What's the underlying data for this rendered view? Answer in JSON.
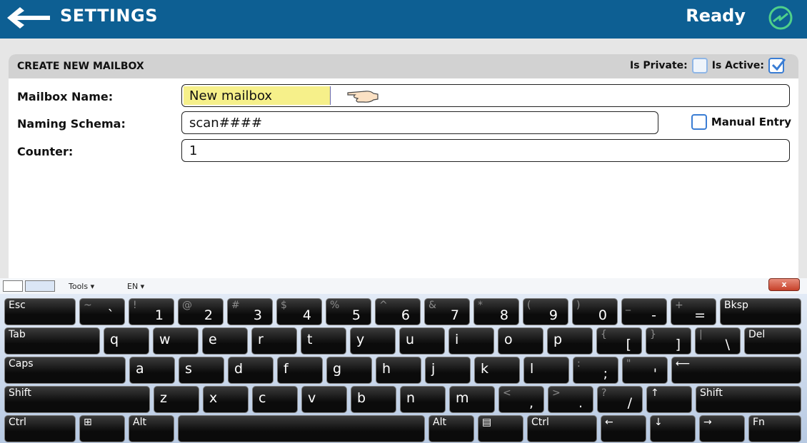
{
  "header": {
    "title": "SETTINGS",
    "status": "Ready"
  },
  "panel": {
    "title": "CREATE NEW MAILBOX",
    "is_private_label": "Is Private:",
    "is_private": false,
    "is_active_label": "Is Active:",
    "is_active": true
  },
  "form": {
    "mailbox_name_label": "Mailbox Name:",
    "mailbox_name_value": "New mailbox",
    "naming_schema_label": "Naming Schema:",
    "naming_schema_value": "scan####",
    "manual_entry_label": "Manual Entry",
    "manual_entry": false,
    "counter_label": "Counter:",
    "counter_value": "1"
  },
  "keyboard": {
    "tools_label": "Tools ▾",
    "lang_label": "EN ▾",
    "close_label": "x",
    "rows": [
      [
        {
          "name": "key-esc",
          "tl": "Esc"
        },
        {
          "name": "key-tilde",
          "sh": "~",
          "br": "`"
        },
        {
          "name": "key-1",
          "sh": "!",
          "br": "1"
        },
        {
          "name": "key-2",
          "sh": "@",
          "br": "2"
        },
        {
          "name": "key-3",
          "sh": "#",
          "br": "3"
        },
        {
          "name": "key-4",
          "sh": "$",
          "br": "4"
        },
        {
          "name": "key-5",
          "sh": "%",
          "br": "5"
        },
        {
          "name": "key-6",
          "sh": "^",
          "br": "6"
        },
        {
          "name": "key-7",
          "sh": "&",
          "br": "7"
        },
        {
          "name": "key-8",
          "sh": "*",
          "br": "8"
        },
        {
          "name": "key-9",
          "sh": "(",
          "br": "9"
        },
        {
          "name": "key-0",
          "sh": ")",
          "br": "0"
        },
        {
          "name": "key-minus",
          "sh": "_",
          "br": "-"
        },
        {
          "name": "key-equals",
          "sh": "+",
          "br": "="
        },
        {
          "name": "key-bksp",
          "tl": "Bksp"
        }
      ],
      [
        {
          "name": "key-tab",
          "tl": "Tab"
        },
        {
          "name": "key-q",
          "lt": "q"
        },
        {
          "name": "key-w",
          "lt": "w"
        },
        {
          "name": "key-e",
          "lt": "e"
        },
        {
          "name": "key-r",
          "lt": "r"
        },
        {
          "name": "key-t",
          "lt": "t"
        },
        {
          "name": "key-y",
          "lt": "y"
        },
        {
          "name": "key-u",
          "lt": "u"
        },
        {
          "name": "key-i",
          "lt": "i"
        },
        {
          "name": "key-o",
          "lt": "o"
        },
        {
          "name": "key-p",
          "lt": "p"
        },
        {
          "name": "key-bracket-left",
          "sh": "{",
          "br": "["
        },
        {
          "name": "key-bracket-right",
          "sh": "}",
          "br": "]"
        },
        {
          "name": "key-backslash",
          "sh": "|",
          "br": "\\"
        },
        {
          "name": "key-del",
          "tl": "Del"
        }
      ],
      [
        {
          "name": "key-caps",
          "tl": "Caps"
        },
        {
          "name": "key-a",
          "lt": "a"
        },
        {
          "name": "key-s",
          "lt": "s"
        },
        {
          "name": "key-d",
          "lt": "d"
        },
        {
          "name": "key-f",
          "lt": "f"
        },
        {
          "name": "key-g",
          "lt": "g"
        },
        {
          "name": "key-h",
          "lt": "h"
        },
        {
          "name": "key-j",
          "lt": "j"
        },
        {
          "name": "key-k",
          "lt": "k"
        },
        {
          "name": "key-l",
          "lt": "l"
        },
        {
          "name": "key-semicolon",
          "sh": ":",
          "br": ";"
        },
        {
          "name": "key-quote",
          "sh": "\"",
          "br": "'"
        },
        {
          "name": "key-enter",
          "tl": "⟵"
        }
      ],
      [
        {
          "name": "key-shift-left",
          "tl": "Shift"
        },
        {
          "name": "key-z",
          "lt": "z"
        },
        {
          "name": "key-x",
          "lt": "x"
        },
        {
          "name": "key-c",
          "lt": "c"
        },
        {
          "name": "key-v",
          "lt": "v"
        },
        {
          "name": "key-b",
          "lt": "b"
        },
        {
          "name": "key-n",
          "lt": "n"
        },
        {
          "name": "key-m",
          "lt": "m"
        },
        {
          "name": "key-comma",
          "sh": "<",
          "br": ","
        },
        {
          "name": "key-period",
          "sh": ">",
          "br": "."
        },
        {
          "name": "key-slash",
          "sh": "?",
          "br": "/"
        },
        {
          "name": "key-up",
          "tl": "↑"
        },
        {
          "name": "key-shift-right",
          "tl": "Shift"
        }
      ],
      [
        {
          "name": "key-ctrl-left",
          "tl": "Ctrl"
        },
        {
          "name": "key-win",
          "tl": "⊞"
        },
        {
          "name": "key-alt-left",
          "tl": "Alt"
        },
        {
          "name": "key-space",
          "tl": ""
        },
        {
          "name": "key-alt-right",
          "tl": "Alt"
        },
        {
          "name": "key-menu",
          "tl": "▤"
        },
        {
          "name": "key-ctrl-right",
          "tl": "Ctrl"
        },
        {
          "name": "key-left",
          "tl": "←"
        },
        {
          "name": "key-down",
          "tl": "↓"
        },
        {
          "name": "key-right",
          "tl": "→"
        },
        {
          "name": "key-fn",
          "tl": "Fn"
        }
      ]
    ]
  }
}
